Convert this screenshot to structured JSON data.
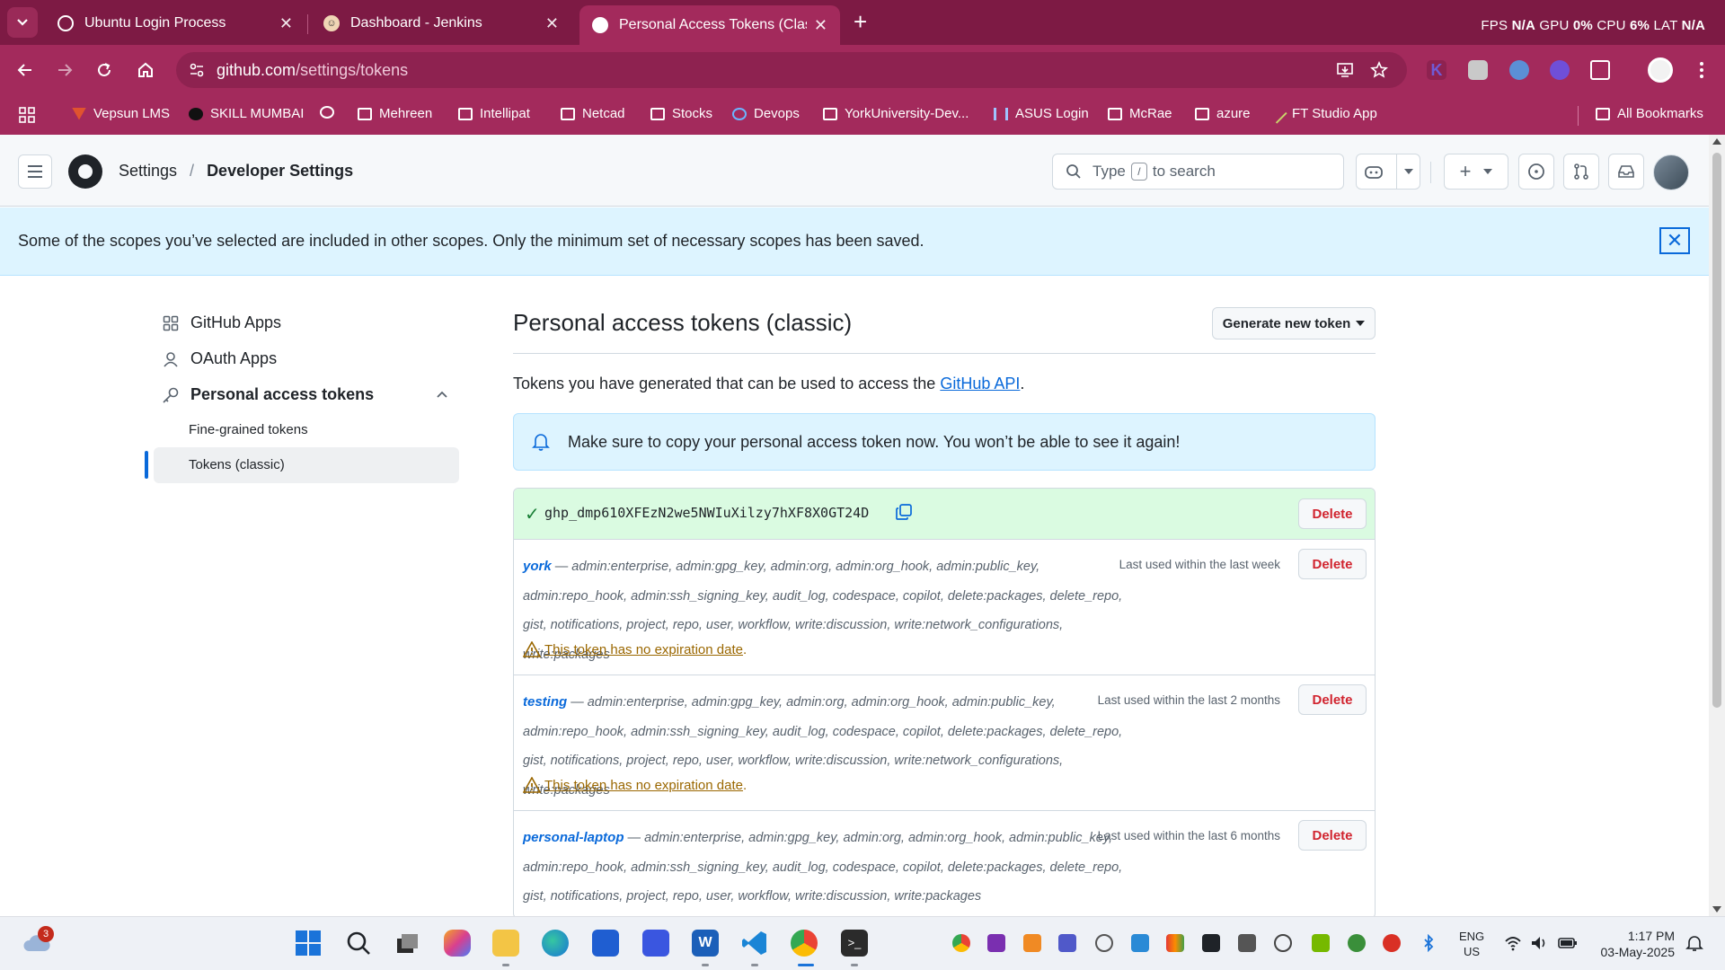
{
  "browser": {
    "tabs": [
      {
        "title": "Ubuntu Login Process",
        "active": false
      },
      {
        "title": "Dashboard - Jenkins",
        "active": false
      },
      {
        "title": "Personal Access Tokens (Classic)",
        "active": true
      }
    ],
    "perf": {
      "fps_label": "FPS",
      "fps": "N/A",
      "gpu_label": "GPU",
      "gpu": "0%",
      "cpu_label": "CPU",
      "cpu": "6%",
      "lat_label": "LAT",
      "lat": "N/A"
    },
    "url_host": "github.com",
    "url_path": "/settings/tokens",
    "bookmarks": [
      "Vepsun LMS",
      "SKILL MUMBAI",
      "Mehreen",
      "Intellipat",
      "Netcad",
      "Stocks",
      "Devops",
      "YorkUniversity-Dev...",
      "ASUS Login",
      "McRae",
      "azure",
      "FT Studio App",
      "All Bookmarks"
    ]
  },
  "header": {
    "breadcrumb_parent": "Settings",
    "breadcrumb_current": "Developer Settings",
    "search_prefix": "Type",
    "search_key": "/",
    "search_suffix": "to search"
  },
  "flash": {
    "message": "Some of the scopes you’ve selected are included in other scopes. Only the minimum set of necessary scopes has been saved."
  },
  "sidebar": {
    "items": [
      {
        "label": "GitHub Apps",
        "icon": "apps-grid-icon"
      },
      {
        "label": "OAuth Apps",
        "icon": "person-icon"
      },
      {
        "label": "Personal access tokens",
        "icon": "key-icon"
      }
    ],
    "subitems": [
      {
        "label": "Fine-grained tokens",
        "active": false
      },
      {
        "label": "Tokens (classic)",
        "active": true
      }
    ]
  },
  "main": {
    "title": "Personal access tokens (classic)",
    "generate_button": "Generate new token",
    "intro_text": "Tokens you have generated that can be used to access the",
    "intro_link": "GitHub API",
    "intro_end": ".",
    "notice": "Make sure to copy your personal access token now. You won’t be able to see it again!",
    "new_token": "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",
    "delete_label": "Delete",
    "warning_text": "This token has no expiration date",
    "tokens": [
      {
        "name": "york",
        "dash": "—",
        "scopes": "admin:enterprise, admin:gpg_key, admin:org, admin:org_hook, admin:public_key, admin:repo_hook, admin:ssh_signing_key, audit_log, codespace, copilot, delete:packages, delete_repo, gist, notifications, project, repo, user, workflow, write:discussion, write:network_configurations, write:packages",
        "last_used": "Last used within the last week"
      },
      {
        "name": "testing",
        "dash": "—",
        "scopes": "admin:enterprise, admin:gpg_key, admin:org, admin:org_hook, admin:public_key, admin:repo_hook, admin:ssh_signing_key, audit_log, codespace, copilot, delete:packages, delete_repo, gist, notifications, project, repo, user, workflow, write:discussion, write:network_configurations, write:packages",
        "last_used": "Last used within the last 2 months"
      },
      {
        "name": "personal-laptop",
        "dash": "—",
        "scopes": "admin:enterprise, admin:gpg_key, admin:org, admin:org_hook, admin:public_key, admin:repo_hook, admin:ssh_signing_key, audit_log, codespace, copilot, delete:packages, delete_repo, gist, notifications, project, repo, user, workflow, write:discussion, write:packages",
        "last_used": "Last used within the last 6 months"
      }
    ]
  },
  "taskbar": {
    "weather_badge": "3",
    "lang_top": "ENG",
    "lang_bottom": "US",
    "time": "1:17 PM",
    "date": "03-May-2025"
  },
  "colors": {
    "chrome_frame": "#7d1a44",
    "chrome_toolbar": "#a32a5c",
    "link": "#0969da",
    "danger": "#d1242f",
    "attention": "#9a6700",
    "success_bg": "#dafbe1",
    "info_bg": "#ddf4ff"
  }
}
